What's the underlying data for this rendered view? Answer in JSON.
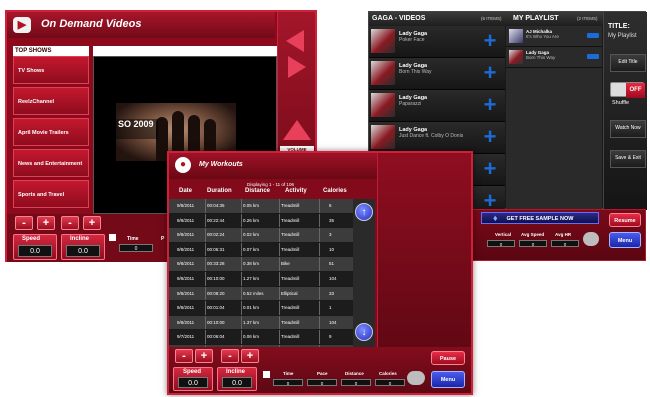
{
  "ondemand": {
    "title": "On Demand Videos",
    "section_label": "TOP SHOWS",
    "shows": [
      "TV Shows",
      "ReelzChannel",
      "April Movie Trailers",
      "News and Entertainment",
      "Sports and Travel"
    ],
    "thumb_caption": "SO 2009",
    "volume_label": "VOLUME",
    "bottom": {
      "minus": "-",
      "plus": "+",
      "speed_label": "Speed",
      "speed_value": "0.0",
      "incline_label": "Incline",
      "incline_value": "0.0",
      "time_label": "Time",
      "time_value": "0",
      "pace_label": "P"
    }
  },
  "playlist": {
    "videos_title": "GAGA - VIDEOS",
    "videos_count": "(6 ITEMS)",
    "playlist_title": "MY PLAYLIST",
    "playlist_count": "(2 ITEMS)",
    "videos": [
      {
        "artist": "Lady Gaga",
        "song": "Poker Face"
      },
      {
        "artist": "Lady Gaga",
        "song": "Born This Way"
      },
      {
        "artist": "Lady Gaga",
        "song": "Paparazzi"
      },
      {
        "artist": "Lady Gaga",
        "song": "Just Dance ft. Colby O Donis"
      }
    ],
    "playlist_items": [
      {
        "artist": "AJ Michalka",
        "song": "It's Who You Are"
      },
      {
        "artist": "Lady Gaga",
        "song": "Born This Way"
      }
    ],
    "side": {
      "title_label": "TITLE:",
      "title_value": "My Playlist",
      "edit_title": "Edit Title",
      "shuffle_state": "OFF",
      "shuffle_label": "Shuffle",
      "watch_now": "Watch Now",
      "save_exit": "Save & Exit"
    },
    "promo": "GET FREE SAMPLE NOW",
    "resume": "Resume",
    "menu": "Menu",
    "stats": [
      {
        "label": "Vertical",
        "value": "0"
      },
      {
        "label": "Avg Speed",
        "value": "0"
      },
      {
        "label": "Avg HR",
        "value": "0"
      }
    ]
  },
  "workouts": {
    "title": "My Workouts",
    "displaying": "Displaying 1 - 11 of 106",
    "columns": [
      "Date",
      "Duration",
      "Distance",
      "Activity",
      "Calories"
    ],
    "rows": [
      [
        "9/8/2011",
        "00:04:35",
        "0.05 km",
        "Treadmill",
        "6"
      ],
      [
        "9/8/2011",
        "00:22:44",
        "0.26 km",
        "Treadmill",
        "35"
      ],
      [
        "9/8/2011",
        "00:02:24",
        "0.02 km",
        "Treadmill",
        "3"
      ],
      [
        "9/8/2011",
        "00:06:31",
        "0.07 km",
        "Treadmill",
        "10"
      ],
      [
        "9/8/2011",
        "00:33:28",
        "0.38 km",
        "Bike",
        "51"
      ],
      [
        "9/8/2011",
        "00:10:00",
        "1.27 km",
        "Treadmill",
        "104"
      ],
      [
        "9/8/2011",
        "00:08:20",
        "0.52 miles",
        "Elliptical",
        "33"
      ],
      [
        "9/8/2011",
        "00:01:04",
        "0.01 km",
        "Treadmill",
        "1"
      ],
      [
        "9/8/2011",
        "00:10:00",
        "1.37 km",
        "Treadmill",
        "104"
      ],
      [
        "9/7/2011",
        "00:06:04",
        "0.06 km",
        "Treadmill",
        "9"
      ],
      [
        "9/7/2011",
        "00:06:00",
        "0.06 km",
        "Treadmill",
        "9"
      ]
    ],
    "bottom": {
      "minus": "-",
      "plus": "+",
      "speed_label": "Speed",
      "speed_value": "0.0",
      "incline_label": "Incline",
      "incline_value": "0.0",
      "stats": [
        {
          "label": "Time",
          "value": "0"
        },
        {
          "label": "Pace",
          "value": "0"
        },
        {
          "label": "Distance",
          "value": "0"
        },
        {
          "label": "Calories",
          "value": "0"
        }
      ],
      "pause": "Pause",
      "menu": "Menu"
    }
  },
  "colors": {
    "brand_red": "#b01020",
    "accent_blue": "#2a3ad0",
    "dark": "#1a1a1a"
  }
}
